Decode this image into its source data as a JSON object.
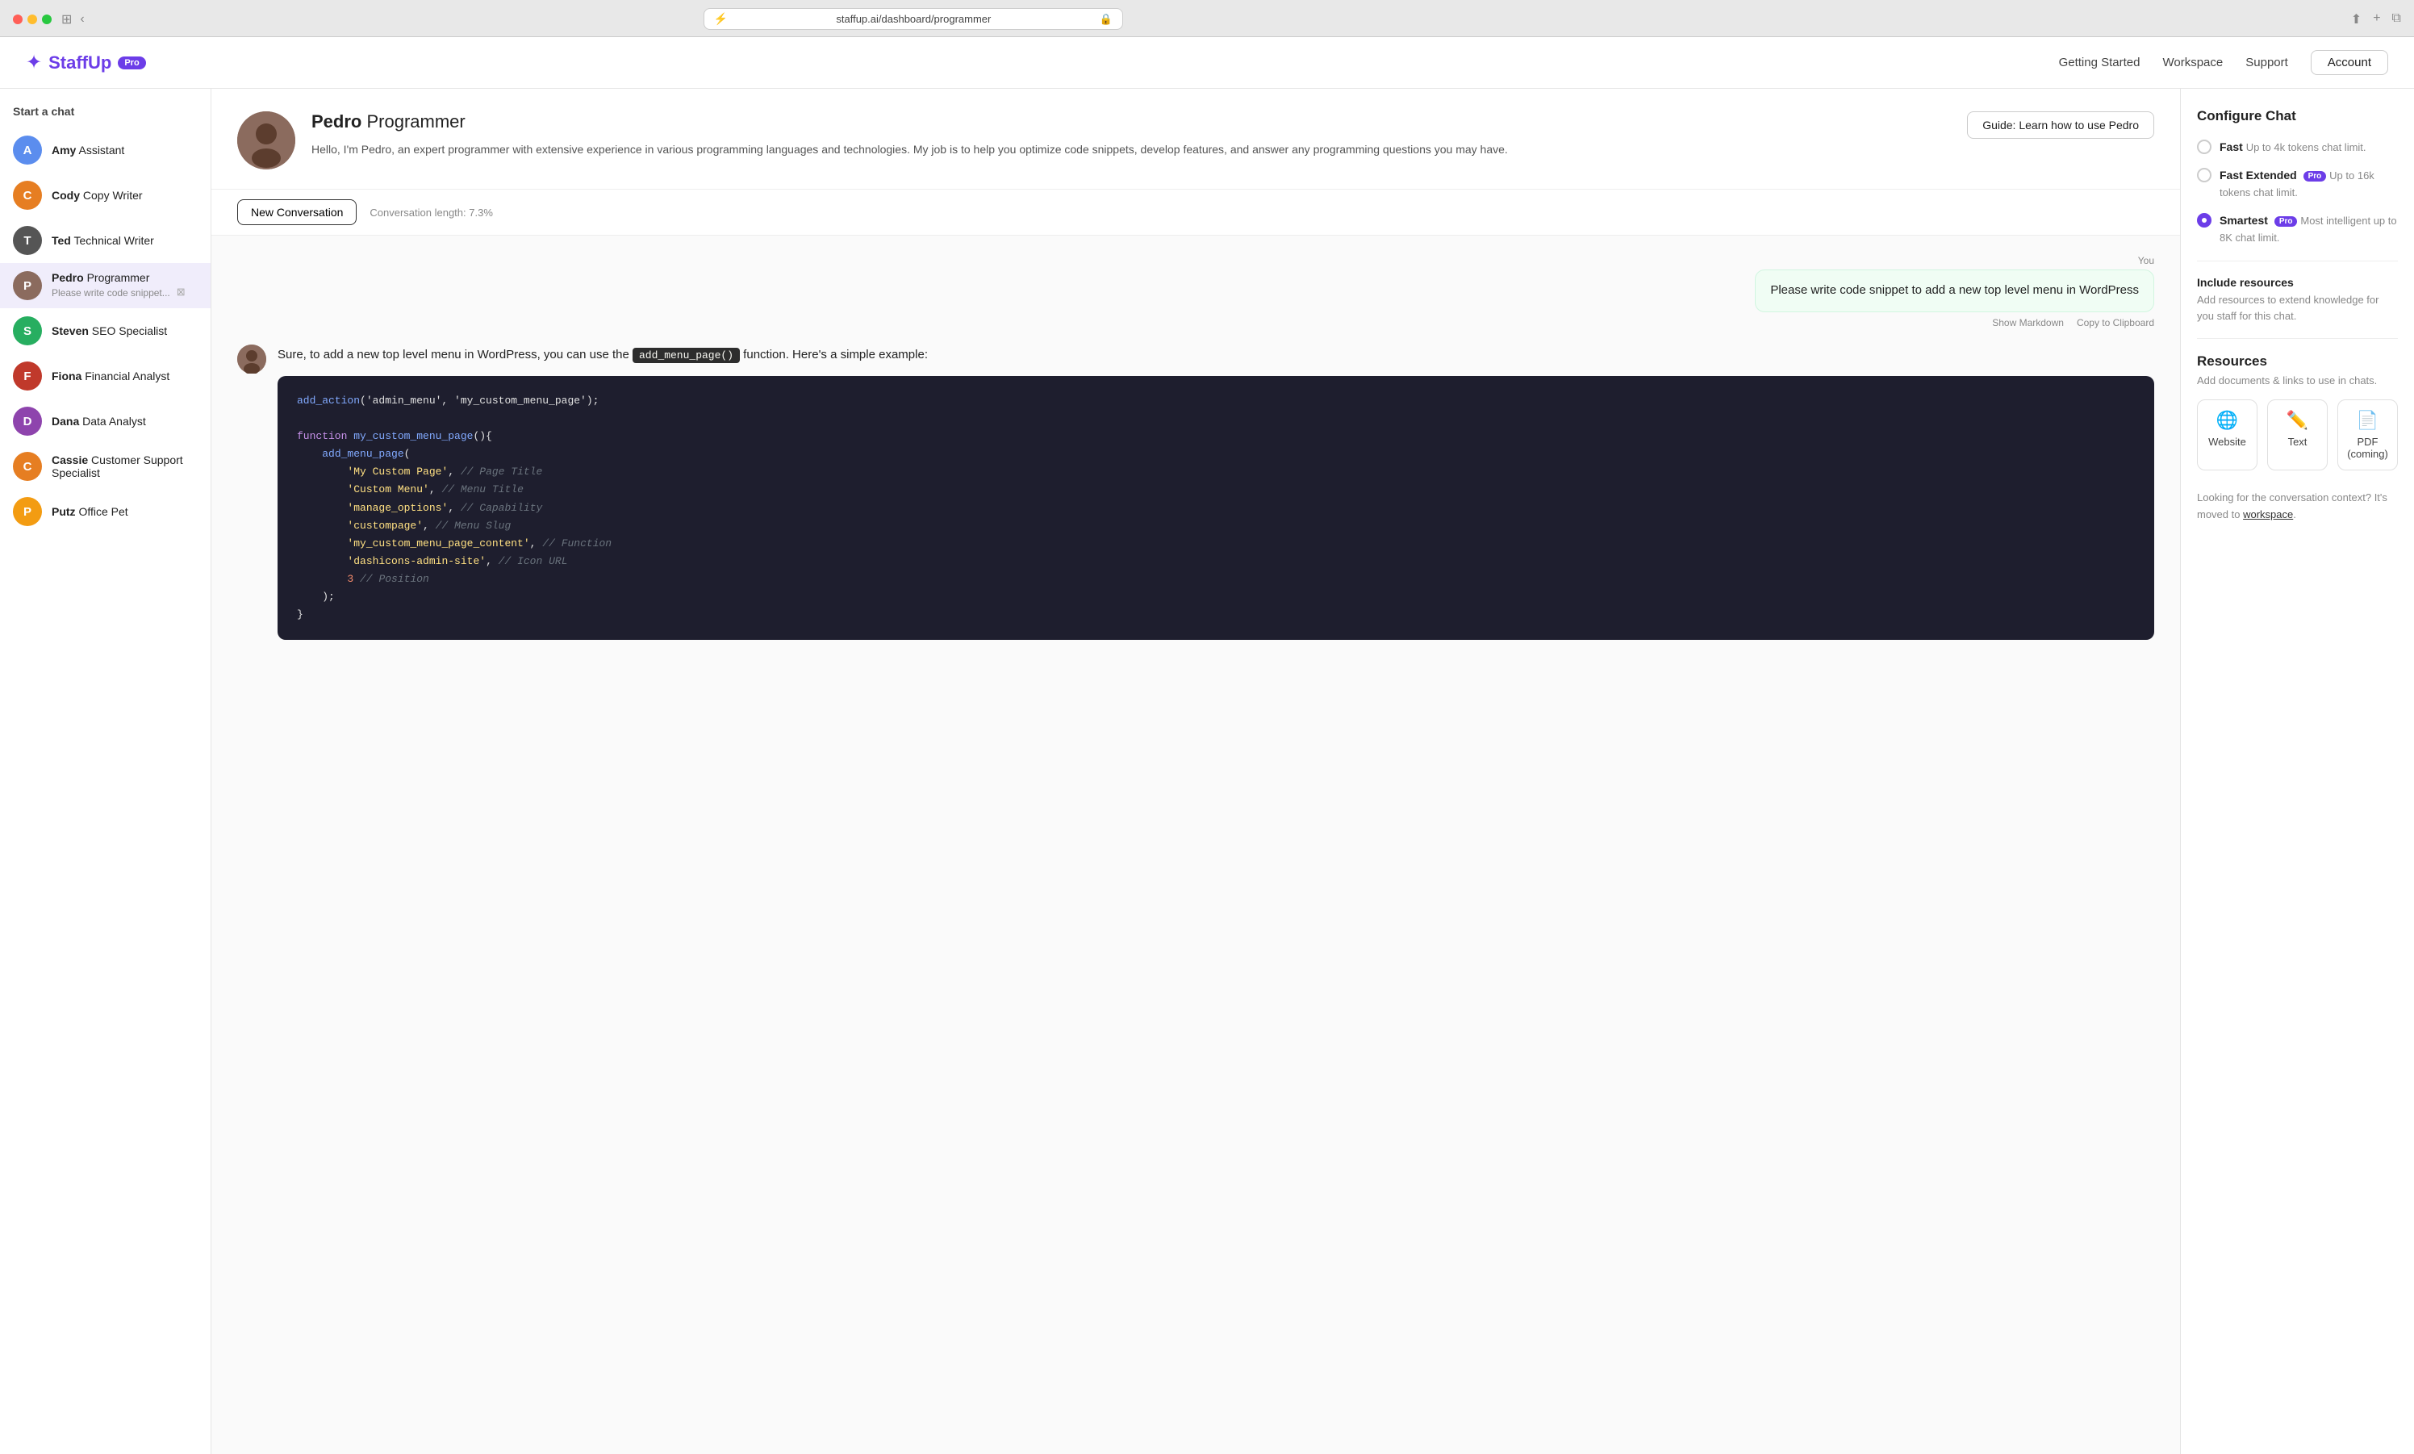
{
  "browser": {
    "url": "staffup.ai/dashboard/programmer",
    "favicon": "⚡"
  },
  "header": {
    "logo_icon": "✦",
    "logo_text_bold": "Staff",
    "logo_text_rest": "Up",
    "pro_badge": "Pro",
    "nav": {
      "getting_started": "Getting Started",
      "workspace": "Workspace",
      "support": "Support",
      "account": "Account"
    }
  },
  "sidebar": {
    "heading": "Start a chat",
    "items": [
      {
        "id": "amy",
        "first": "Amy",
        "rest": "Assistant",
        "color": "#5b8dee",
        "initial": "A",
        "active": false,
        "preview": null
      },
      {
        "id": "cody",
        "first": "Cody",
        "rest": "Copy Writer",
        "color": "#e67e22",
        "initial": "C",
        "active": false,
        "preview": null
      },
      {
        "id": "ted",
        "first": "Ted",
        "rest": "Technical Writer",
        "color": "#555",
        "initial": "T",
        "active": false,
        "preview": null
      },
      {
        "id": "pedro",
        "first": "Pedro",
        "rest": "Programmer",
        "color": "#8B6B5E",
        "initial": "P",
        "active": true,
        "preview": "Please write code snippet..."
      },
      {
        "id": "steven",
        "first": "Steven",
        "rest": "SEO Specialist",
        "color": "#27ae60",
        "initial": "S",
        "active": false,
        "preview": null
      },
      {
        "id": "fiona",
        "first": "Fiona",
        "rest": "Financial Analyst",
        "color": "#c0392b",
        "initial": "F",
        "active": false,
        "preview": null
      },
      {
        "id": "dana",
        "first": "Dana",
        "rest": "Data Analyst",
        "color": "#8e44ad",
        "initial": "D",
        "active": false,
        "preview": null
      },
      {
        "id": "cassie",
        "first": "Cassie",
        "rest": "Customer Support Specialist",
        "color": "#e67e22",
        "initial": "C",
        "active": false,
        "preview": null
      },
      {
        "id": "putz",
        "first": "Putz",
        "rest": "Office Pet",
        "color": "#f39c12",
        "initial": "P",
        "active": false,
        "preview": null
      }
    ]
  },
  "agent": {
    "name_bold": "Pedro",
    "name_rest": " Programmer",
    "description": "Hello, I'm Pedro, an expert programmer with extensive experience in various programming languages and technologies. My job is to help you optimize code snippets, develop features, and answer any programming questions you may have.",
    "guide_btn": "Guide: Learn how to use Pedro",
    "avatar_color": "#8B6B5E"
  },
  "conversation": {
    "new_conv_label": "New Conversation",
    "length_label": "Conversation length: 7.3%"
  },
  "messages": [
    {
      "type": "user",
      "label": "You",
      "text": "Please write code snippet to add a new top level menu in WordPress",
      "show_markdown": "Show Markdown",
      "copy_clipboard": "Copy to Clipboard"
    },
    {
      "type": "agent",
      "intro": "Sure, to add a new top level menu in WordPress, you can use the",
      "inline_code": "add_menu_page()",
      "outro": " function. Here's a simple example:",
      "code_lines": [
        {
          "type": "green",
          "text": "add_action('admin_menu', 'my_custom_menu_page');"
        },
        {
          "type": "blank"
        },
        {
          "type": "purple",
          "text": "function ",
          "rest_type": "blue",
          "rest": "my_custom_menu_page(){"
        },
        {
          "type": "indent1_blue",
          "text": "    add_menu_page("
        },
        {
          "type": "indent2_yellow",
          "text": "        'My Custom Page',",
          "comment": " // Page Title"
        },
        {
          "type": "indent2_yellow",
          "text": "        'Custom Menu',",
          "comment": " // Menu Title"
        },
        {
          "type": "indent2_yellow",
          "text": "        'manage_options',",
          "comment": " // Capability"
        },
        {
          "type": "indent2_yellow",
          "text": "        'custompage',",
          "comment": " // Menu Slug"
        },
        {
          "type": "indent2_yellow",
          "text": "        'my_custom_menu_page_content',",
          "comment": " // Function"
        },
        {
          "type": "indent2_yellow",
          "text": "        'dashicons-admin-site',",
          "comment": " // Icon URL"
        },
        {
          "type": "indent2_orange",
          "text": "        3",
          "comment": " // Position"
        },
        {
          "type": "indent1_white",
          "text": "    );"
        },
        {
          "type": "white",
          "text": "}"
        }
      ]
    }
  ],
  "right_panel": {
    "configure_title": "Configure Chat",
    "options": [
      {
        "id": "fast",
        "label": "Fast",
        "sub": "Up to 4k tokens chat limit.",
        "badge": null,
        "selected": false
      },
      {
        "id": "fast_extended",
        "label": "Fast Extended",
        "sub": "Up to 16k tokens chat limit.",
        "badge": "Pro",
        "selected": false
      },
      {
        "id": "smartest",
        "label": "Smartest",
        "sub": "Most intelligent up to 8K chat limit.",
        "badge": "Pro",
        "selected": true
      }
    ],
    "include_resources_title": "Include resources",
    "include_resources_desc": "Add resources to extend knowledge for you staff for this chat.",
    "resources_title": "Resources",
    "resources_desc": "Add documents & links to use in chats.",
    "resource_buttons": [
      {
        "id": "website",
        "icon": "🌐",
        "label": "Website"
      },
      {
        "id": "text",
        "icon": "✏️",
        "label": "Text"
      },
      {
        "id": "pdf",
        "icon": "📄",
        "label": "PDF\n(coming)"
      }
    ],
    "workspace_note": "Looking for the conversation context? It's moved to",
    "workspace_link": "workspace",
    "workspace_note2": "."
  }
}
